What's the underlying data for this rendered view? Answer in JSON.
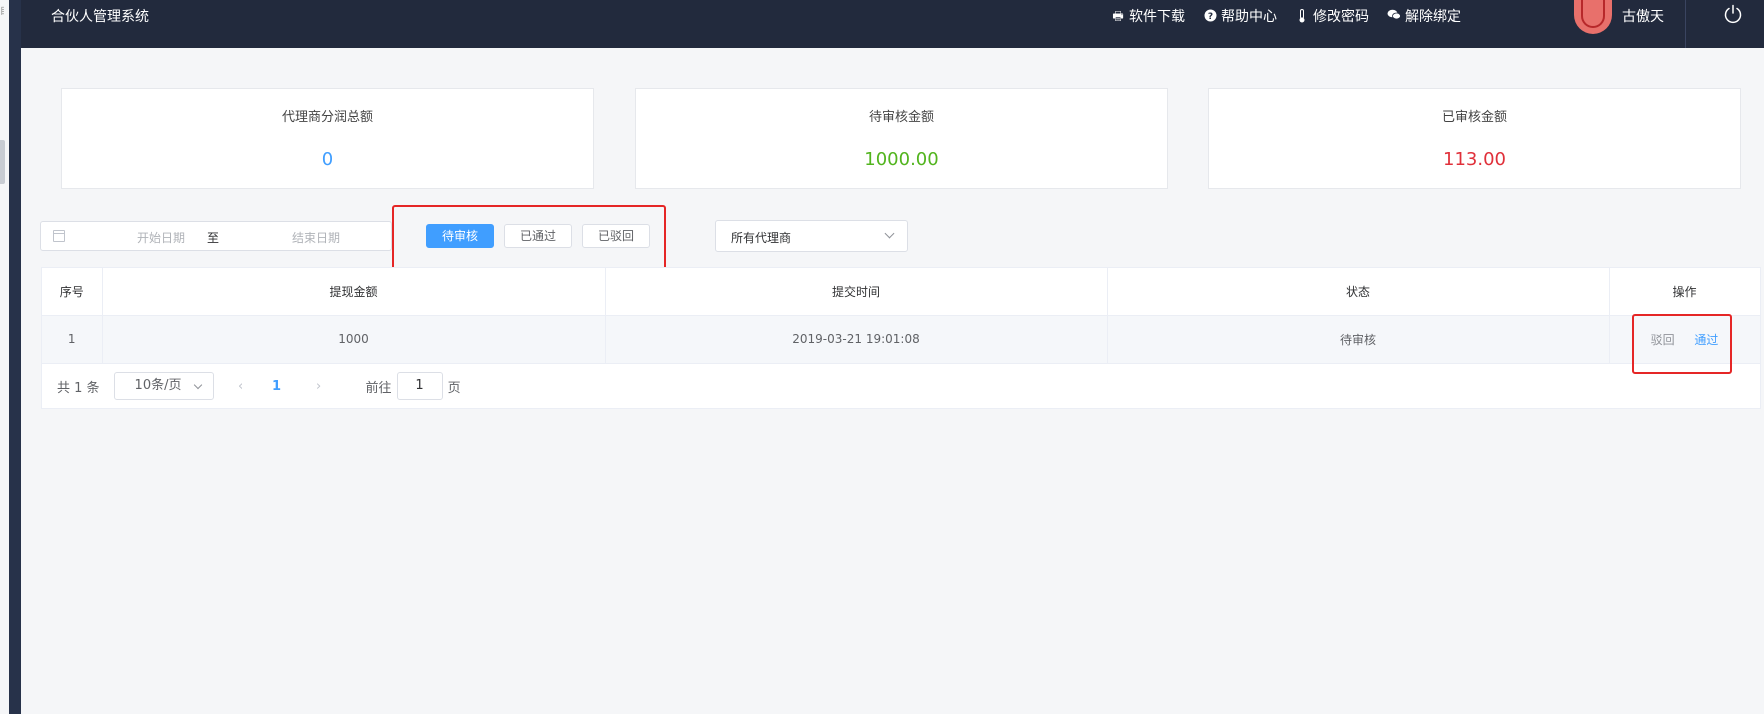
{
  "sidebar": {
    "mark": "目"
  },
  "header": {
    "title": "合伙人管理系统",
    "nav": [
      {
        "label": "软件下载",
        "icon": "printer-icon",
        "glyph": "🖶"
      },
      {
        "label": "帮助中心",
        "icon": "help-icon",
        "glyph": "?"
      },
      {
        "label": "修改密码",
        "icon": "thermometer-icon",
        "glyph": "🌡"
      },
      {
        "label": "解除绑定",
        "icon": "chat-icon",
        "glyph": "💬"
      }
    ],
    "user_name": "古傲天"
  },
  "stats": [
    {
      "label": "代理商分润总额",
      "value": "0",
      "color": "#409eff"
    },
    {
      "label": "待审核金额",
      "value": "1000.00",
      "color": "#52b41e"
    },
    {
      "label": "已审核金额",
      "value": "113.00",
      "color": "#e0303a"
    }
  ],
  "filters": {
    "start_placeholder": "开始日期",
    "separator": "至",
    "end_placeholder": "结束日期",
    "status_buttons": [
      "待审核",
      "已通过",
      "已驳回"
    ],
    "agent_select": "所有代理商"
  },
  "table": {
    "columns": [
      "序号",
      "提现金额",
      "提交时间",
      "状态",
      "操作"
    ],
    "rows": [
      {
        "index": "1",
        "amount": "1000",
        "time": "2019-03-21 19:01:08",
        "status": "待审核",
        "reject": "驳回",
        "pass": "通过"
      }
    ]
  },
  "pagination": {
    "total": "共 1 条",
    "page_size": "10条/页",
    "current_page": "1",
    "goto_label": "前往",
    "goto_value": "1",
    "page_suffix": "页"
  },
  "colors": {
    "topbar": "#222a3d",
    "primary": "#409eff",
    "highlight": "#e52626"
  }
}
